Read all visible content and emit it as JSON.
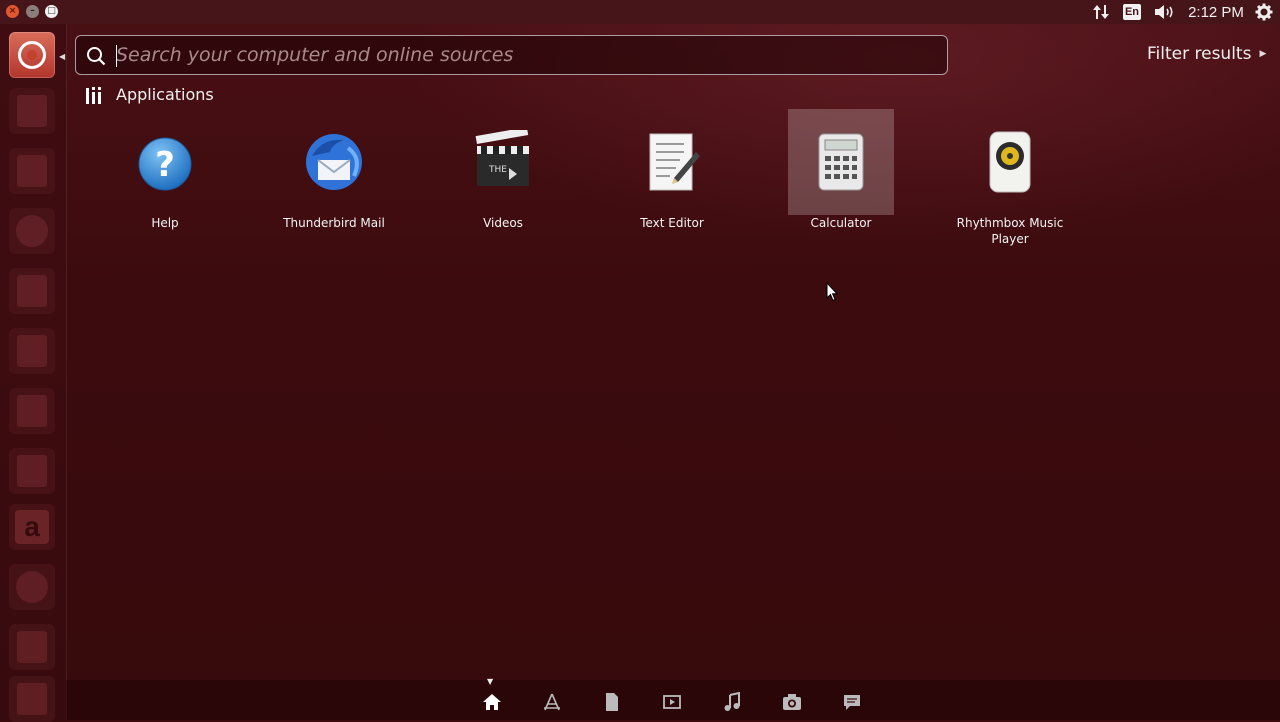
{
  "top_panel": {
    "window_buttons": {
      "close": "×",
      "minimize": "–",
      "maximize": "□"
    },
    "keyboard_layout": "En",
    "clock": "2:12 PM",
    "icons": [
      "network-updown-icon",
      "keyboard-layout-icon",
      "volume-icon",
      "session-gear-icon"
    ]
  },
  "search": {
    "placeholder": "Search your computer and online sources",
    "value": ""
  },
  "filter": {
    "label": "Filter results"
  },
  "category": {
    "title": "Applications"
  },
  "apps": [
    {
      "label": "Help",
      "icon": "help-icon"
    },
    {
      "label": "Thunderbird Mail",
      "icon": "thunderbird-icon"
    },
    {
      "label": "Videos",
      "icon": "videos-icon"
    },
    {
      "label": "Text Editor",
      "icon": "text-editor-icon"
    },
    {
      "label": "Calculator",
      "icon": "calculator-icon",
      "highlighted": true
    },
    {
      "label": "Rhythmbox Music Player",
      "icon": "rhythmbox-icon"
    }
  ],
  "launcher": {
    "items": [
      "dash-home",
      "files",
      "archive",
      "browser",
      "writer",
      "impress",
      "calc",
      "software",
      "amazon",
      "settings",
      "store",
      "drive"
    ]
  },
  "lenses": [
    "home",
    "applications",
    "files",
    "videos",
    "music",
    "photos",
    "social"
  ],
  "colors": {
    "background": "#3a0a0d",
    "accent": "#e2572d",
    "panel": "#45151a"
  }
}
